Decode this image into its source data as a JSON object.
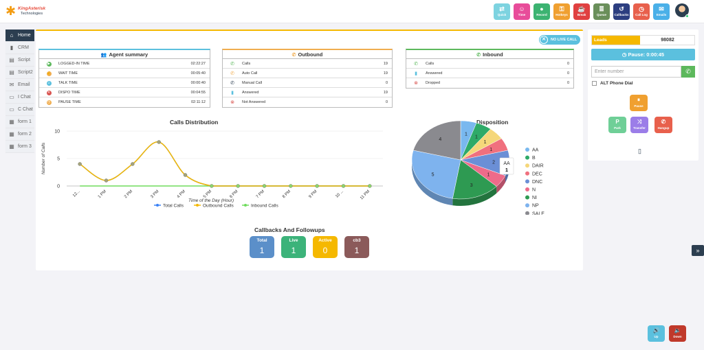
{
  "brand": {
    "line1": "KingAsterisk",
    "line2": "Technologies"
  },
  "top_buttons": [
    {
      "label": "Quick",
      "icon": "swap-icon",
      "color": "#7dd3e0"
    },
    {
      "label": "Time",
      "icon": "user-icon",
      "color": "#e84c9a"
    },
    {
      "label": "Record",
      "icon": "record-icon",
      "color": "#3cb371"
    },
    {
      "label": "Hotkeys",
      "icon": "key-icon",
      "color": "#f0a030"
    },
    {
      "label": "Break",
      "icon": "coffee-icon",
      "color": "#e04040"
    },
    {
      "label": "Queue",
      "icon": "queue-icon",
      "color": "#6a8f5a"
    },
    {
      "label": "Callbacks",
      "icon": "callbacks-icon",
      "color": "#2c3e80"
    },
    {
      "label": "Call Log",
      "icon": "clock-icon",
      "color": "#e8604c"
    },
    {
      "label": "Emails",
      "icon": "email-icon",
      "color": "#4ab0e8"
    }
  ],
  "sidebar": [
    {
      "label": "Home",
      "icon": "home-icon",
      "active": true
    },
    {
      "label": "CRM",
      "icon": "chart-icon"
    },
    {
      "label": "Script",
      "icon": "file-icon"
    },
    {
      "label": "Script2",
      "icon": "file-icon"
    },
    {
      "label": "Email",
      "icon": "email-icon"
    },
    {
      "label": "I Chat",
      "icon": "chat-icon"
    },
    {
      "label": "C Chat",
      "icon": "chat-icon"
    },
    {
      "label": "form 1",
      "icon": "form-icon"
    },
    {
      "label": "form 2",
      "icon": "form-icon"
    },
    {
      "label": "form 3",
      "icon": "form-icon"
    }
  ],
  "no_live_call": "NO LIVE CALL",
  "agent_summary": {
    "title": "Agent summary",
    "rows": [
      {
        "label": "LOGGED-IN TIME",
        "value": "02:22:27",
        "color": "#5cb85c"
      },
      {
        "label": "WAIT TIME",
        "value": "00:05:40",
        "color": "#f0ad4e"
      },
      {
        "label": "TALK TIME",
        "value": "00:00:40",
        "color": "#5bc0de"
      },
      {
        "label": "DISPO TIME",
        "value": "00:04:55",
        "color": "#d9534f"
      },
      {
        "label": "PAUSE TIME",
        "value": "02:11:12",
        "color": "#f0ad4e"
      }
    ]
  },
  "outbound": {
    "title": "Outbound",
    "rows": [
      {
        "label": "Calls",
        "value": "19"
      },
      {
        "label": "Auto Call",
        "value": "19"
      },
      {
        "label": "Manual Call",
        "value": "0"
      },
      {
        "label": "Answered",
        "value": "19"
      },
      {
        "label": "Not Answered",
        "value": "0"
      }
    ]
  },
  "inbound": {
    "title": "Inbound",
    "rows": [
      {
        "label": "Calls",
        "value": "0"
      },
      {
        "label": "Answered",
        "value": "0"
      },
      {
        "label": "Dropped",
        "value": "0"
      }
    ]
  },
  "callbacks": {
    "title": "Callbacks And Followups",
    "items": [
      {
        "label": "Total",
        "value": "1",
        "color": "#5b8fc9"
      },
      {
        "label": "Live",
        "value": "1",
        "color": "#3cb37a"
      },
      {
        "label": "Active",
        "value": "0",
        "color": "#f5b800"
      },
      {
        "label": "cb3",
        "value": "1",
        "color": "#8b5a5a"
      }
    ]
  },
  "right_panel": {
    "leads_label": "Leads",
    "leads_value": "98082",
    "pause_label": "Pause: 0:00:45",
    "number_placeholder": "Enter number",
    "alt_phone_label": "ALT Phone Dial",
    "actions": [
      {
        "label": "Pause",
        "icon": "pause-icon",
        "color": "#f0a030"
      },
      {
        "label": "Park",
        "icon": "park-icon",
        "color": "#6fcf97"
      },
      {
        "label": "Transfer",
        "icon": "transfer-icon",
        "color": "#9b7de8"
      },
      {
        "label": "Hangup",
        "icon": "hangup-icon",
        "color": "#e8604c"
      }
    ]
  },
  "bottom_buttons": [
    {
      "label": "Up",
      "icon": "volume-up-icon",
      "color": "#5bc0de"
    },
    {
      "label": "Down",
      "icon": "volume-down-icon",
      "color": "#c0392b"
    }
  ],
  "chart_data": [
    {
      "type": "line",
      "title": "Calls Distribution",
      "xlabel": "Time of the Day (Hour)",
      "ylabel": "Number of Calls",
      "categories": [
        "12...",
        "1 PM",
        "2 PM",
        "3 PM",
        "4 PM",
        "5 PM",
        "6 PM",
        "7 PM",
        "8 PM",
        "9 PM",
        "10 ...",
        "11 PM"
      ],
      "ylim": [
        0,
        10
      ],
      "yticks": [
        0,
        5,
        10
      ],
      "series": [
        {
          "name": "Total Calls",
          "color": "#3b82f6",
          "values": [
            4,
            1,
            4,
            8,
            2,
            0,
            0,
            0,
            0,
            0,
            0,
            0
          ]
        },
        {
          "name": "Outbound Calls",
          "color": "#f5b800",
          "values": [
            4,
            1,
            4,
            8,
            2,
            0,
            0,
            0,
            0,
            0,
            0,
            0
          ]
        },
        {
          "name": "Inbound Calls",
          "color": "#6fdc5c",
          "values": [
            0,
            0,
            0,
            0,
            0,
            0,
            0,
            0,
            0,
            0,
            0,
            0
          ]
        }
      ],
      "legend": "bottom"
    },
    {
      "type": "pie",
      "title": "Disposition",
      "tooltip": {
        "label": "AA",
        "value": "1"
      },
      "slices": [
        {
          "label": "AA",
          "value": 1,
          "color": "#79b8ef"
        },
        {
          "label": "B",
          "value": 1,
          "color": "#2eaa68"
        },
        {
          "label": "DAIR",
          "value": 1,
          "color": "#f5d77a"
        },
        {
          "label": "DEC",
          "value": 1,
          "color": "#f0707e"
        },
        {
          "label": "DNC",
          "value": 2,
          "color": "#6b8fd6"
        },
        {
          "label": "N",
          "value": 1,
          "color": "#ee6b8a"
        },
        {
          "label": "NI",
          "value": 3,
          "color": "#2e9a52"
        },
        {
          "label": "NP",
          "value": 5,
          "color": "#7eb3ee"
        },
        {
          "label": "SALE",
          "value": 4,
          "color": "#8a8a8f"
        }
      ],
      "legend": "right"
    }
  ]
}
